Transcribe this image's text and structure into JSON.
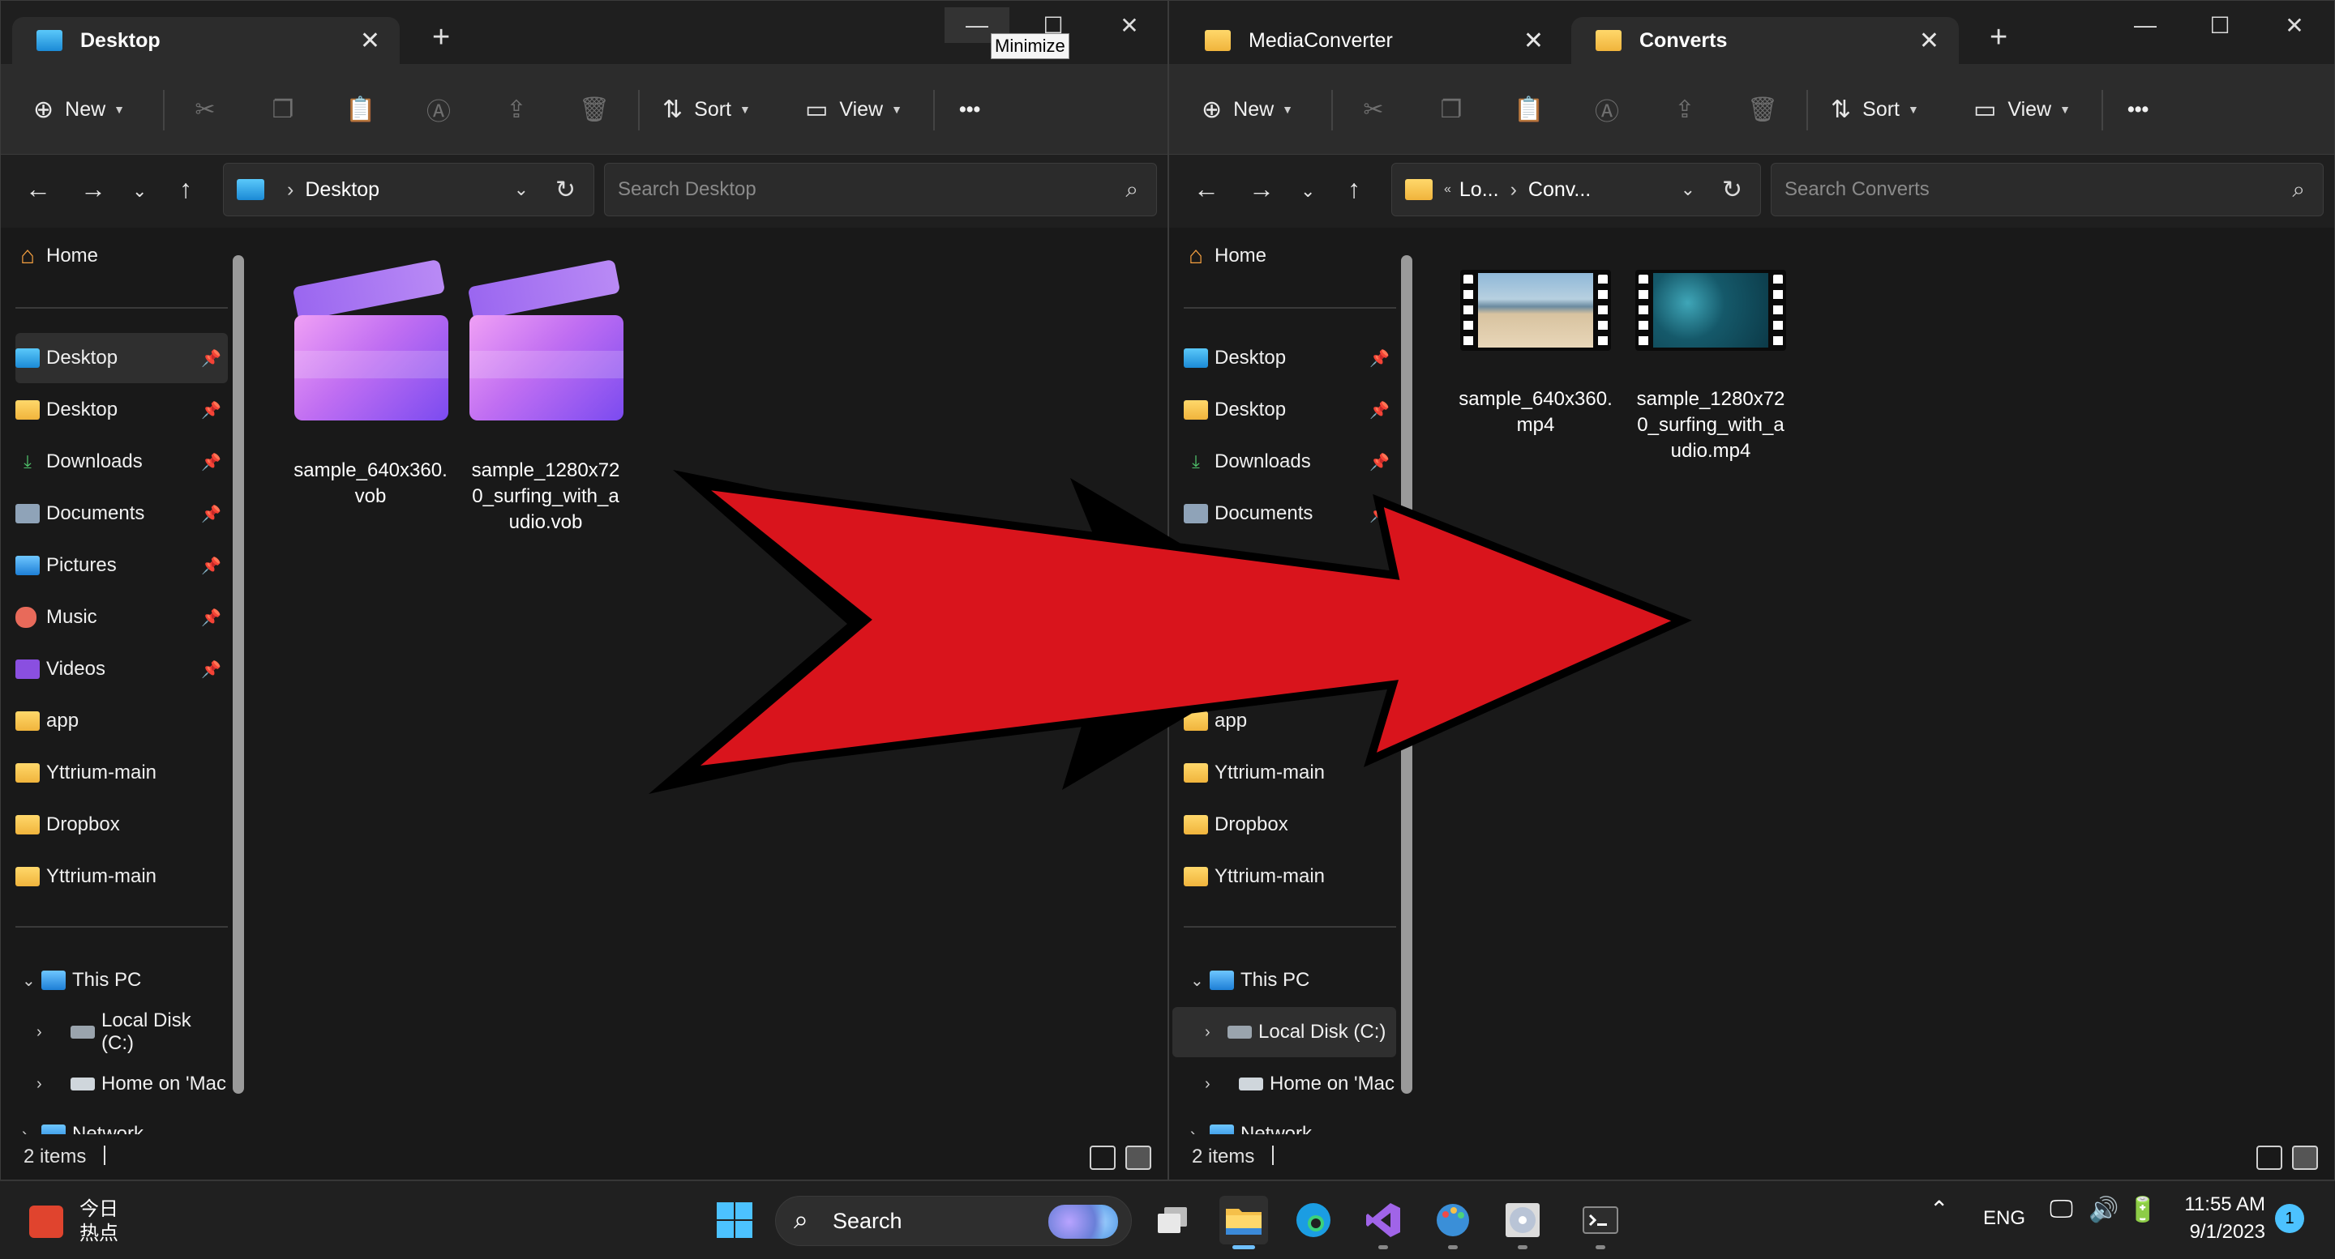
{
  "left_window": {
    "tabs": [
      {
        "label": "Desktop",
        "close": "✕"
      }
    ],
    "new_tab": "+",
    "tooltip": "Minimize",
    "toolbar": {
      "new": "New",
      "sort": "Sort",
      "view": "View",
      "more": "•••"
    },
    "address": {
      "path": "Desktop",
      "search_placeholder": "Search Desktop"
    },
    "files": [
      {
        "name": "sample_640x360.\nvob"
      },
      {
        "name": "sample_1280x72\n0_surfing_with_a\nudio.vob"
      }
    ],
    "status": {
      "count": "2 items"
    }
  },
  "right_window": {
    "tabs": [
      {
        "label": "MediaConverter",
        "close": "✕"
      },
      {
        "label": "Converts",
        "close": "✕"
      }
    ],
    "new_tab": "+",
    "toolbar": {
      "new": "New",
      "sort": "Sort",
      "view": "View",
      "more": "•••"
    },
    "address": {
      "crumb1": "Lo...",
      "crumb2": "Conv...",
      "search_placeholder": "Search Converts"
    },
    "files": [
      {
        "name": "sample_640x360.\nmp4"
      },
      {
        "name": "sample_1280x72\n0_surfing_with_a\nudio.mp4"
      }
    ],
    "status": {
      "count": "2 items"
    }
  },
  "sidebar": {
    "home": "Home",
    "quick_access": [
      {
        "label": "Desktop",
        "icon": "desktop-icon",
        "pinned": true
      },
      {
        "label": "Desktop",
        "icon": "folder-icon",
        "pinned": true
      },
      {
        "label": "Downloads",
        "icon": "download-icon",
        "pinned": true
      },
      {
        "label": "Documents",
        "icon": "documents-icon",
        "pinned": true
      },
      {
        "label": "Pictures",
        "icon": "pictures-icon",
        "pinned": true
      },
      {
        "label": "Music",
        "icon": "music-icon",
        "pinned": true
      },
      {
        "label": "Videos",
        "icon": "videos-icon",
        "pinned": true
      },
      {
        "label": "app",
        "icon": "folder-icon",
        "pinned": false
      },
      {
        "label": "Yttrium-main",
        "icon": "folder-icon",
        "pinned": false
      },
      {
        "label": "Dropbox",
        "icon": "folder-icon",
        "pinned": false
      },
      {
        "label": "Yttrium-main",
        "icon": "folder-icon",
        "pinned": false
      }
    ],
    "this_pc": "This PC",
    "local_disk": "Local Disk (C:)",
    "home_mac": "Home on 'Mac",
    "network": "Network"
  },
  "taskbar": {
    "widget_line1": "今日",
    "widget_line2": "热点",
    "search": "Search",
    "language": "ENG",
    "time": "11:55 AM",
    "date": "9/1/2023",
    "notifications": "1"
  },
  "colors": {
    "folder": "#f5c04a",
    "arrow_fill": "#d9141c",
    "accent": "#4cc2ff"
  }
}
